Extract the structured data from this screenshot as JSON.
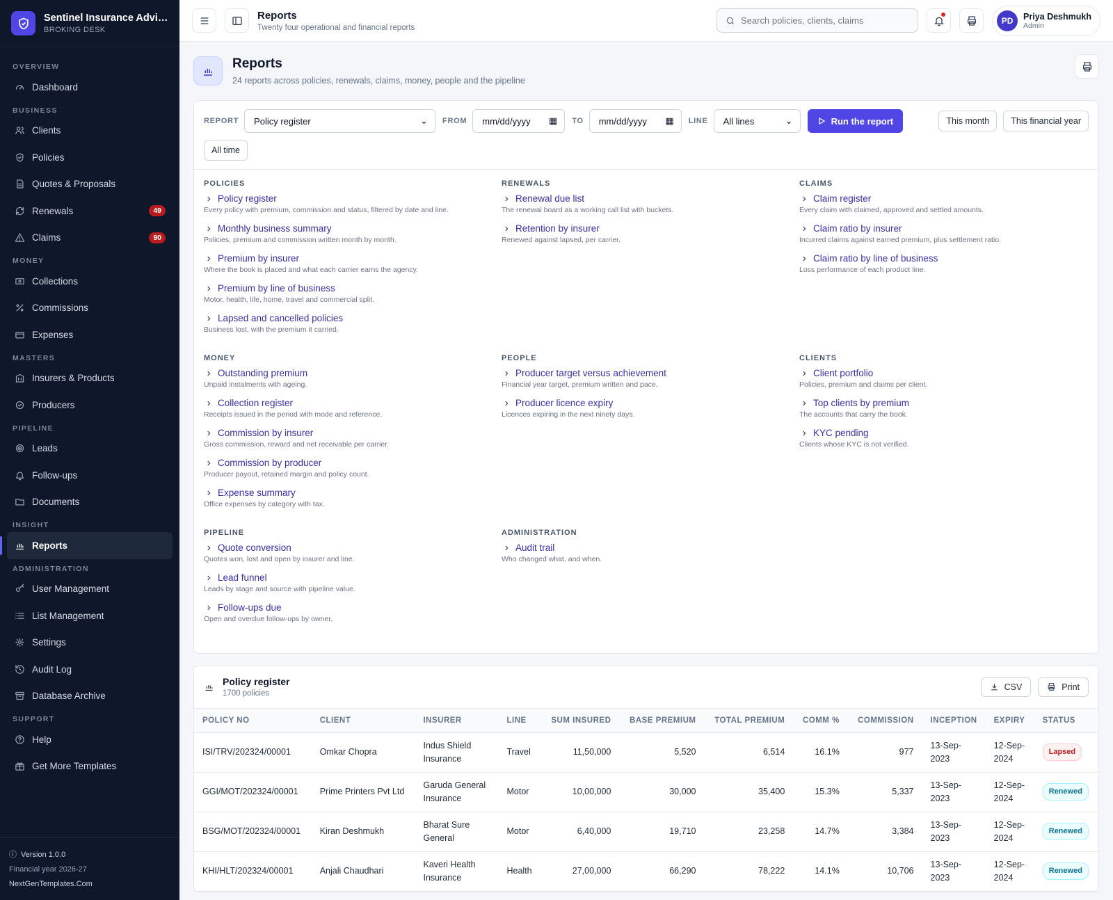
{
  "brand": {
    "title": "Sentinel Insurance Advisor...",
    "subtitle": "BROKING DESK"
  },
  "sidebar": {
    "sections": [
      {
        "label": "OVERVIEW",
        "items": [
          {
            "label": "Dashboard",
            "icon": "gauge-icon"
          }
        ]
      },
      {
        "label": "BUSINESS",
        "items": [
          {
            "label": "Clients",
            "icon": "users-icon"
          },
          {
            "label": "Policies",
            "icon": "shield-icon"
          },
          {
            "label": "Quotes & Proposals",
            "icon": "document-icon"
          },
          {
            "label": "Renewals",
            "icon": "refresh-icon",
            "badge": "49"
          },
          {
            "label": "Claims",
            "icon": "warning-icon",
            "badge": "90"
          }
        ]
      },
      {
        "label": "MONEY",
        "items": [
          {
            "label": "Collections",
            "icon": "banknote-icon"
          },
          {
            "label": "Commissions",
            "icon": "percent-icon"
          },
          {
            "label": "Expenses",
            "icon": "wallet-icon"
          }
        ]
      },
      {
        "label": "MASTERS",
        "items": [
          {
            "label": "Insurers & Products",
            "icon": "building-icon"
          },
          {
            "label": "Producers",
            "icon": "badge-icon"
          }
        ]
      },
      {
        "label": "PIPELINE",
        "items": [
          {
            "label": "Leads",
            "icon": "target-icon"
          },
          {
            "label": "Follow-ups",
            "icon": "bell-icon"
          },
          {
            "label": "Documents",
            "icon": "folder-icon"
          }
        ]
      },
      {
        "label": "INSIGHT",
        "items": [
          {
            "label": "Reports",
            "icon": "bar-chart-icon",
            "active": true
          }
        ]
      },
      {
        "label": "ADMINISTRATION",
        "items": [
          {
            "label": "User Management",
            "icon": "key-icon"
          },
          {
            "label": "List Management",
            "icon": "list-icon"
          },
          {
            "label": "Settings",
            "icon": "gear-icon"
          },
          {
            "label": "Audit Log",
            "icon": "history-icon"
          },
          {
            "label": "Database Archive",
            "icon": "archive-icon"
          }
        ]
      },
      {
        "label": "SUPPORT",
        "items": [
          {
            "label": "Help",
            "icon": "help-icon"
          },
          {
            "label": "Get More Templates",
            "icon": "gift-icon"
          }
        ]
      }
    ],
    "footer": {
      "version": "Version 1.0.0",
      "fy": "Financial year 2026-27",
      "link": "NextGenTemplates.Com"
    }
  },
  "topbar": {
    "title": "Reports",
    "subtitle": "Twenty four operational and financial reports",
    "search_placeholder": "Search policies, clients, claims",
    "user": {
      "initials": "PD",
      "name": "Priya Deshmukh",
      "role": "Admin"
    }
  },
  "page": {
    "title": "Reports",
    "subtitle": "24 reports across policies, renewals, claims, money, people and the pipeline"
  },
  "filters": {
    "report_label": "REPORT",
    "report_value": "Policy register",
    "from_label": "FROM",
    "from_value": "mm/dd/yyyy",
    "to_label": "TO",
    "to_value": "mm/dd/yyyy",
    "line_label": "LINE",
    "line_value": "All lines",
    "run_label": "Run the report",
    "quick": [
      "This month",
      "This financial year",
      "All time"
    ]
  },
  "categories": [
    {
      "title": "POLICIES",
      "reports": [
        {
          "name": "Policy register",
          "desc": "Every policy with premium, commission and status, filtered by date and line."
        },
        {
          "name": "Monthly business summary",
          "desc": "Policies, premium and commission written month by month."
        },
        {
          "name": "Premium by insurer",
          "desc": "Where the book is placed and what each carrier earns the agency."
        },
        {
          "name": "Premium by line of business",
          "desc": "Motor, health, life, home, travel and commercial split."
        },
        {
          "name": "Lapsed and cancelled policies",
          "desc": "Business lost, with the premium it carried."
        }
      ]
    },
    {
      "title": "RENEWALS",
      "reports": [
        {
          "name": "Renewal due list",
          "desc": "The renewal board as a working call list with buckets."
        },
        {
          "name": "Retention by insurer",
          "desc": "Renewed against lapsed, per carrier."
        }
      ]
    },
    {
      "title": "CLAIMS",
      "reports": [
        {
          "name": "Claim register",
          "desc": "Every claim with claimed, approved and settled amounts."
        },
        {
          "name": "Claim ratio by insurer",
          "desc": "Incurred claims against earned premium, plus settlement ratio."
        },
        {
          "name": "Claim ratio by line of business",
          "desc": "Loss performance of each product line."
        }
      ]
    },
    {
      "title": "MONEY",
      "reports": [
        {
          "name": "Outstanding premium",
          "desc": "Unpaid instalments with ageing."
        },
        {
          "name": "Collection register",
          "desc": "Receipts issued in the period with mode and reference."
        },
        {
          "name": "Commission by insurer",
          "desc": "Gross commission, reward and net receivable per carrier."
        },
        {
          "name": "Commission by producer",
          "desc": "Producer payout, retained margin and policy count."
        },
        {
          "name": "Expense summary",
          "desc": "Office expenses by category with tax."
        }
      ]
    },
    {
      "title": "PEOPLE",
      "reports": [
        {
          "name": "Producer target versus achievement",
          "desc": "Financial year target, premium written and pace."
        },
        {
          "name": "Producer licence expiry",
          "desc": "Licences expiring in the next ninety days."
        }
      ]
    },
    {
      "title": "CLIENTS",
      "reports": [
        {
          "name": "Client portfolio",
          "desc": "Policies, premium and claims per client."
        },
        {
          "name": "Top clients by premium",
          "desc": "The accounts that carry the book."
        },
        {
          "name": "KYC pending",
          "desc": "Clients whose KYC is not verified."
        }
      ]
    },
    {
      "title": "PIPELINE",
      "reports": [
        {
          "name": "Quote conversion",
          "desc": "Quotes won, lost and open by insurer and line."
        },
        {
          "name": "Lead funnel",
          "desc": "Leads by stage and source with pipeline value."
        },
        {
          "name": "Follow-ups due",
          "desc": "Open and overdue follow-ups by owner."
        }
      ]
    },
    {
      "title": "ADMINISTRATION",
      "reports": [
        {
          "name": "Audit trail",
          "desc": "Who changed what, and when."
        }
      ]
    }
  ],
  "register": {
    "title": "Policy register",
    "count": "1700 policies",
    "csv_label": "CSV",
    "print_label": "Print",
    "columns": [
      "POLICY NO",
      "CLIENT",
      "INSURER",
      "LINE",
      "SUM INSURED",
      "BASE PREMIUM",
      "TOTAL PREMIUM",
      "COMM %",
      "COMMISSION",
      "INCEPTION",
      "EXPIRY",
      "STATUS"
    ],
    "rows": [
      [
        "ISI/TRV/202324/00001",
        "Omkar Chopra",
        "Indus Shield Insurance",
        "Travel",
        "11,50,000",
        "5,520",
        "6,514",
        "16.1%",
        "977",
        "13-Sep-2023",
        "12-Sep-2024",
        "Lapsed"
      ],
      [
        "GGI/MOT/202324/00001",
        "Prime Printers Pvt Ltd",
        "Garuda General Insurance",
        "Motor",
        "10,00,000",
        "30,000",
        "35,400",
        "15.3%",
        "5,337",
        "13-Sep-2023",
        "12-Sep-2024",
        "Renewed"
      ],
      [
        "BSG/MOT/202324/00001",
        "Kiran Deshmukh",
        "Bharat Sure General",
        "Motor",
        "6,40,000",
        "19,710",
        "23,258",
        "14.7%",
        "3,384",
        "13-Sep-2023",
        "12-Sep-2024",
        "Renewed"
      ],
      [
        "KHI/HLT/202324/00001",
        "Anjali Chaudhari",
        "Kaveri Health Insurance",
        "Health",
        "27,00,000",
        "66,290",
        "78,222",
        "14.1%",
        "10,706",
        "13-Sep-2023",
        "12-Sep-2024",
        "Renewed"
      ]
    ]
  }
}
